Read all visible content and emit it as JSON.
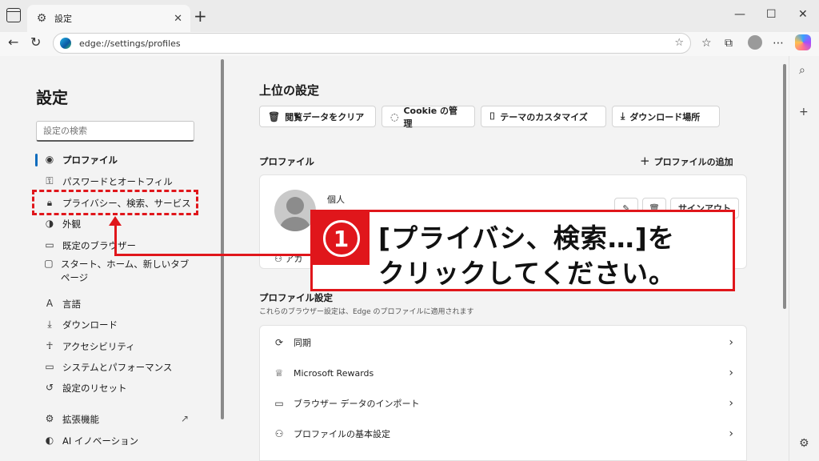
{
  "browser": {
    "tab_label": "設定",
    "tab_close": "✕",
    "new_tab": "+",
    "url": "edge://settings/profiles",
    "win_minimize": "—",
    "win_maximize": "☐",
    "win_close": "✕"
  },
  "sidebar": {
    "title": "設定",
    "search_placeholder": "設定の検索",
    "items": [
      {
        "label": "プロファイル",
        "icon": "profile-icon"
      },
      {
        "label": "パスワードとオートフィル",
        "icon": "key-icon"
      },
      {
        "label": "プライバシー、検索、サービス",
        "icon": "lock-icon"
      },
      {
        "label": "外観",
        "icon": "palette-icon"
      },
      {
        "label": "既定のブラウザー",
        "icon": "browser-icon"
      },
      {
        "label": "スタート、ホーム、新しいタブページ",
        "icon": "home-icon"
      },
      {
        "label": "言語",
        "icon": "language-icon"
      },
      {
        "label": "ダウンロード",
        "icon": "download-icon"
      },
      {
        "label": "アクセシビリティ",
        "icon": "accessibility-icon"
      },
      {
        "label": "システムとパフォーマンス",
        "icon": "laptop-icon"
      },
      {
        "label": "設定のリセット",
        "icon": "reset-icon"
      },
      {
        "label": "拡張機能",
        "icon": "extensions-icon"
      },
      {
        "label": "AI イノベーション",
        "icon": "ai-icon"
      }
    ]
  },
  "main": {
    "top_heading": "上位の設定",
    "quick_buttons": [
      "閲覧データをクリア",
      "Cookie の管理",
      "テーマのカスタマイズ",
      "ダウンロード場所"
    ],
    "profile_heading": "プロファイル",
    "add_profile": "プロファイルの追加",
    "profile_name": "個人",
    "sign_out": "サインアウト",
    "account_row": "アカ",
    "profile_settings_heading": "プロファイル設定",
    "profile_settings_sub": "これらのブラウザー設定は、Edge のプロファイルに適用されます",
    "list": [
      "同期",
      "Microsoft Rewards",
      "ブラウザー データのインポート",
      "プロファイルの基本設定"
    ]
  },
  "callout": {
    "number": "1",
    "line1": "[プライバシ、検索…]を",
    "line2": "クリックしてください。"
  },
  "colors": {
    "accent": "#0f6cbd",
    "highlight_red": "#e0161b"
  }
}
